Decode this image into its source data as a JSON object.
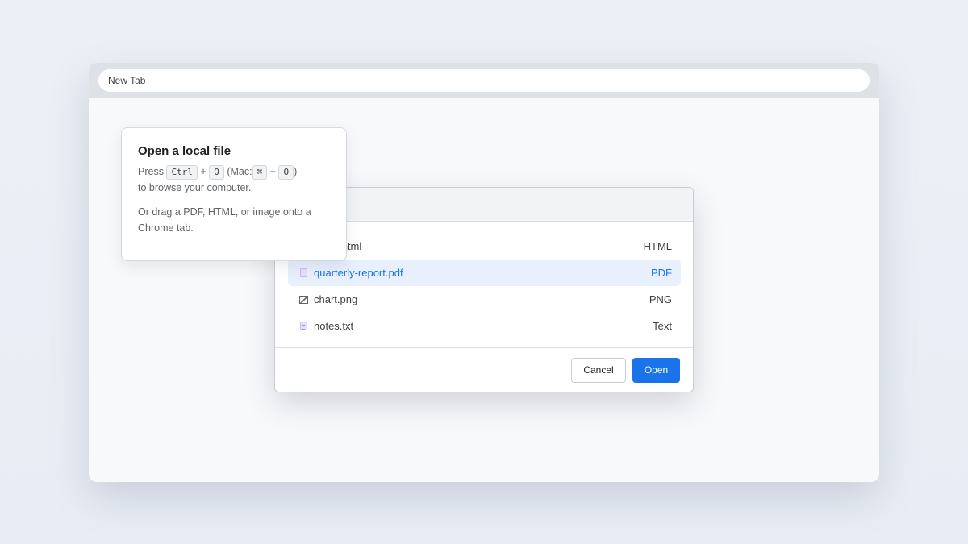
{
  "browser": {
    "tab_title": "New Tab"
  },
  "tooltip": {
    "title": "Open a local file",
    "press": "Press",
    "key_ctrl": "Ctrl",
    "plus": "+",
    "key_o": "O",
    "mac_open": "(Mac:",
    "key_cmd": "⌘",
    "close_paren": ")",
    "line2": "to browse your computer.",
    "para2": "Or drag a PDF, HTML, or image onto a Chrome tab."
  },
  "dialog": {
    "files": [
      {
        "name": "index.html",
        "type": "HTML",
        "icon": "html-file-icon",
        "selected": false
      },
      {
        "name": "quarterly-report.pdf",
        "type": "PDF",
        "icon": "pdf-file-icon",
        "selected": true
      },
      {
        "name": "chart.png",
        "type": "PNG",
        "icon": "image-file-icon",
        "selected": false
      },
      {
        "name": "notes.txt",
        "type": "Text",
        "icon": "text-file-icon",
        "selected": false
      }
    ],
    "cancel_label": "Cancel",
    "open_label": "Open"
  },
  "colors": {
    "accent": "#1a73e8",
    "selected_bg": "#e8f0fe"
  }
}
